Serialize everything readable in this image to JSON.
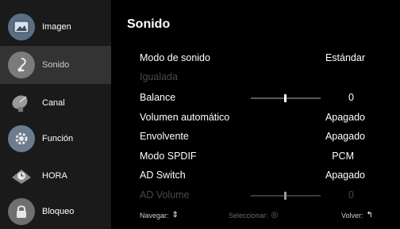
{
  "sidebar": {
    "items": [
      {
        "label": "Imagen",
        "icon": "picture-icon",
        "color": "#5a6f86"
      },
      {
        "label": "Sonido",
        "icon": "music-note-icon",
        "color": "#7b7b7b"
      },
      {
        "label": "Canal",
        "icon": "satellite-dish-icon",
        "color": "#6a6a6a"
      },
      {
        "label": "Función",
        "icon": "gear-icon",
        "color": "#6b7c8f"
      },
      {
        "label": "HORA",
        "icon": "clock-icon",
        "color": "#7a7a7a"
      },
      {
        "label": "Bloqueo",
        "icon": "lock-icon",
        "color": "#6f6f6f"
      }
    ],
    "active_index": 1
  },
  "main": {
    "title": "Sonido",
    "rows": [
      {
        "label": "Modo de sonido",
        "value": "Estándar"
      },
      {
        "label": "Igualada",
        "value": ""
      },
      {
        "label": "Balance",
        "value": "0",
        "slider_level": 0.5
      },
      {
        "label": "Volumen automático",
        "value": "Apagado"
      },
      {
        "label": "Envolvente",
        "value": "Apagado"
      },
      {
        "label": "Modo SPDIF",
        "value": "PCM"
      },
      {
        "label": "AD Switch",
        "value": "Apagado"
      },
      {
        "label": "AD Volume",
        "value": "0",
        "slider_level": 0.5
      }
    ]
  },
  "footer": {
    "navigate_label": "Navegar:",
    "select_label": "Seleccionar:",
    "back_label": "Volver:"
  },
  "colors": {
    "sidebar_bg": "#1a1a1a",
    "active_bg": "#333333",
    "main_bg": "#000000",
    "disabled_text": "#4a4a4a"
  }
}
